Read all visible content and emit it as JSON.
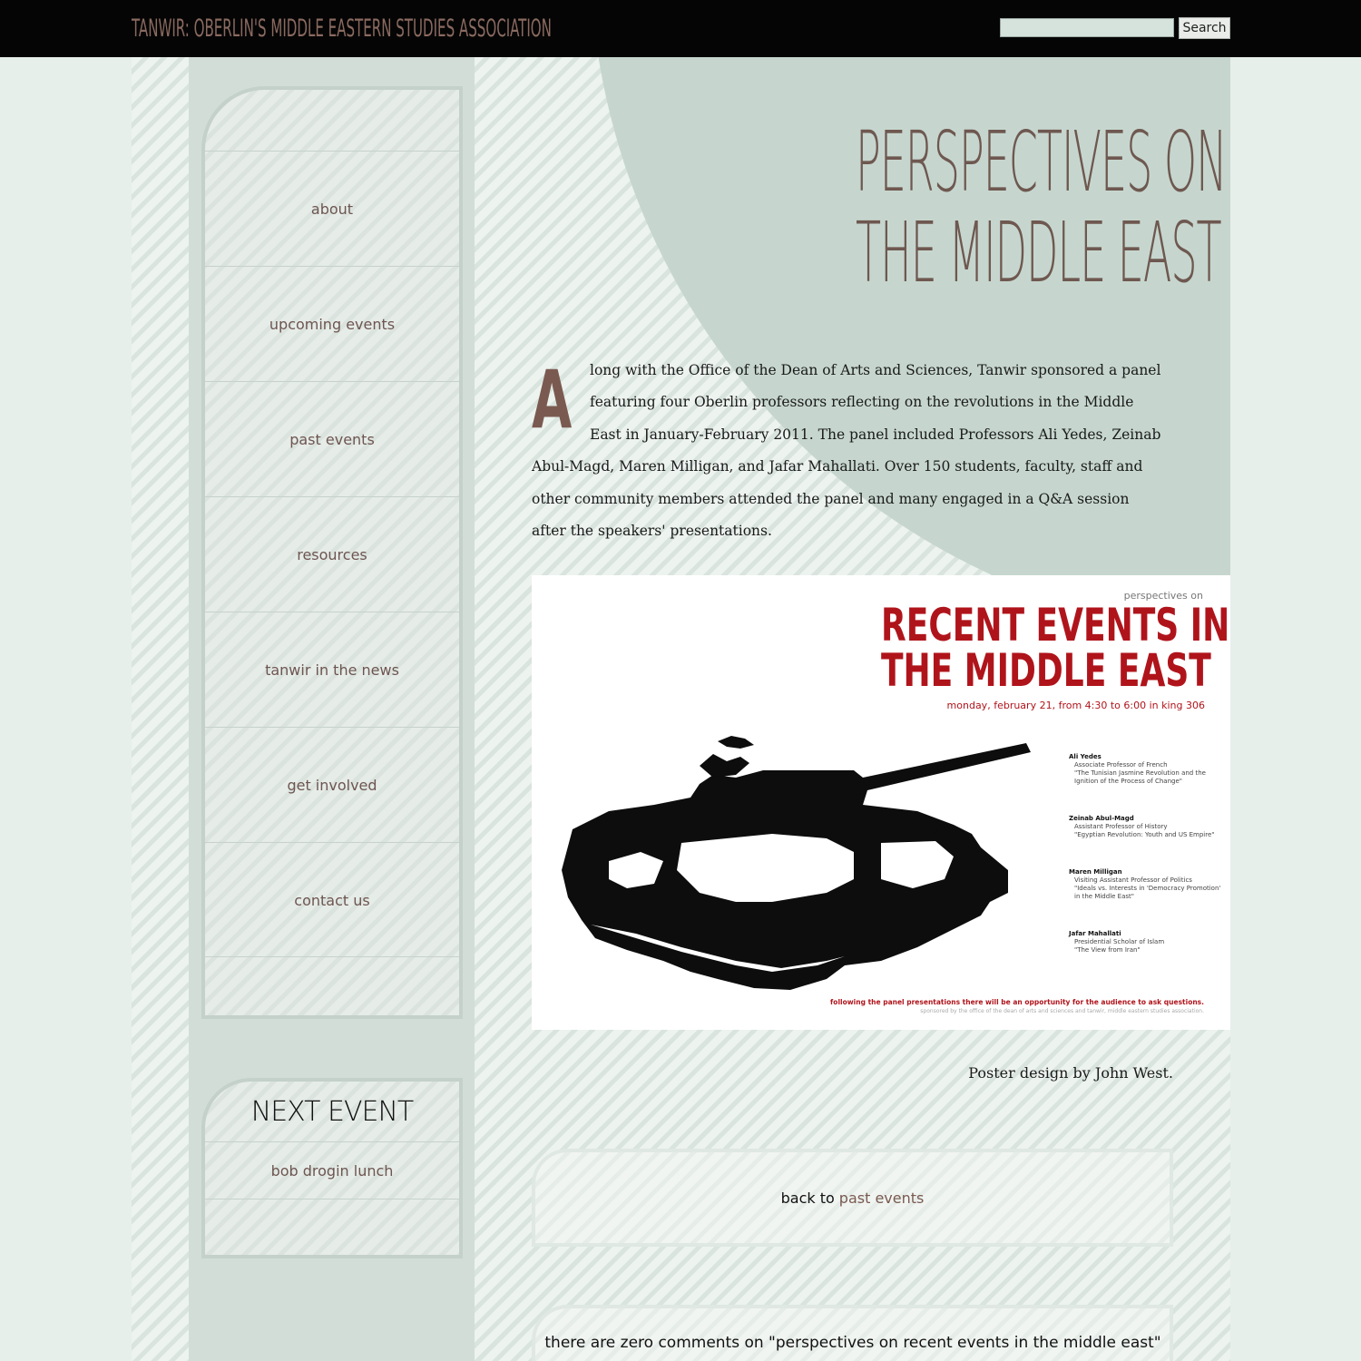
{
  "header": {
    "site_title": "Tanwir: Oberlin's Middle Eastern Studies Association",
    "search_placeholder": "",
    "search_button": "Search"
  },
  "sidebar": {
    "nav": [
      {
        "label": "about"
      },
      {
        "label": "upcoming events"
      },
      {
        "label": "past events"
      },
      {
        "label": "resources"
      },
      {
        "label": "tanwir in the news"
      },
      {
        "label": "get involved"
      },
      {
        "label": "contact us"
      }
    ],
    "next_event": {
      "title": "NEXT EVENT",
      "item": "bob drogin lunch"
    }
  },
  "article": {
    "title_line1": "Perspectives on Recent Events in",
    "title_line2": "the Middle East",
    "drop_cap": "A",
    "body": "long with the Office of the Dean of Arts and Sciences, Tanwir sponsored a panel featuring four Oberlin professors reflecting on the revolutions in the Middle East in January-February 2011.  The panel included Professors Ali Yedes, Zeinab Abul-Magd, Maren Milligan, and Jafar Mahallati. Over 150 students, faculty, staff and other community members attended the panel and many engaged in a Q&A session after the speakers' presentations.",
    "caption": "Poster design by John West."
  },
  "poster": {
    "kicker": "perspectives on",
    "title_line1": "Recent Events in",
    "title_line2": "The Middle East",
    "date": "monday, february 21, from 4:30 to 6:00 in king 306",
    "speakers": [
      {
        "name": "Ali Yedes",
        "role": "Associate Professor of French",
        "talk": "\"The Tunisian Jasmine Revolution and the Ignition of the Process of Change\""
      },
      {
        "name": "Zeinab Abul-Magd",
        "role": "Assistant Professor of History",
        "talk": "\"Egyptian Revolution: Youth and US Empire\""
      },
      {
        "name": "Maren Milligan",
        "role": "Visiting Assistant Professor of Politics",
        "talk": "\"Ideals vs. Interests in 'Democracy Promotion' in the Middle East\""
      },
      {
        "name": "Jafar Mahallati",
        "role": "Presidential Scholar of Islam",
        "talk": "\"The View from Iran\""
      }
    ],
    "footer": "following the panel presentations there will be an opportunity for the audience to ask questions.",
    "footer2": "sponsored by the office of the dean of arts and sciences and tanwir, middle eastern studies association."
  },
  "back": {
    "prefix": "back to",
    "link": "past events"
  },
  "comments": {
    "text": "there are zero comments on \"perspectives on recent events in the middle east\""
  },
  "colors": {
    "top_bar": "#050505",
    "accent_brown": "#6e5850",
    "poster_red": "#b0141b",
    "background": "#e6efea"
  }
}
